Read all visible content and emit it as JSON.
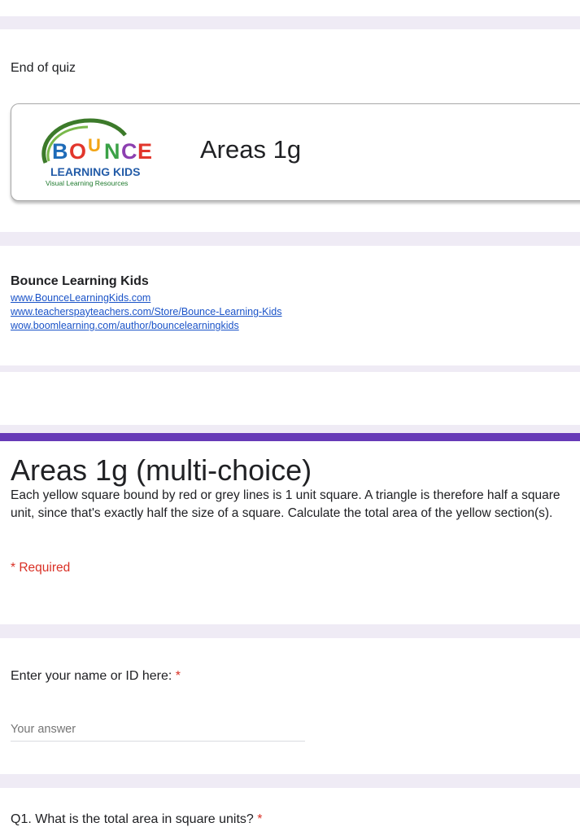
{
  "end_of_quiz": "End of quiz",
  "logo": {
    "title": "Areas 1g",
    "brand_top": "BOUNCE",
    "brand_mid": "LEARNING KIDS",
    "brand_sub": "Visual Learning Resources"
  },
  "credits": {
    "heading": "Bounce Learning Kids",
    "links": [
      "www.BounceLearningKids.com",
      "www.teacherspayteachers.com/Store/Bounce-Learning-Kids",
      "wow.boomlearning.com/author/bouncelearningkids"
    ]
  },
  "form": {
    "title": "Areas 1g (multi-choice)",
    "description": "Each yellow square bound by red or grey lines is 1 unit square. A triangle is therefore half a square unit, since that's exactly half the size of a square. Calculate the total area of the yellow section(s).",
    "required_note": "* Required",
    "name_question": "Enter your name or ID here:",
    "required_star": "*",
    "answer_placeholder": "Your answer",
    "next_question": "Q1. What is the total area in square units?",
    "next_question_star": "*"
  },
  "colors": {
    "accent": "#673ab7",
    "background_band": "#efebf5",
    "required": "#d93025",
    "link": "#1a53c8"
  }
}
